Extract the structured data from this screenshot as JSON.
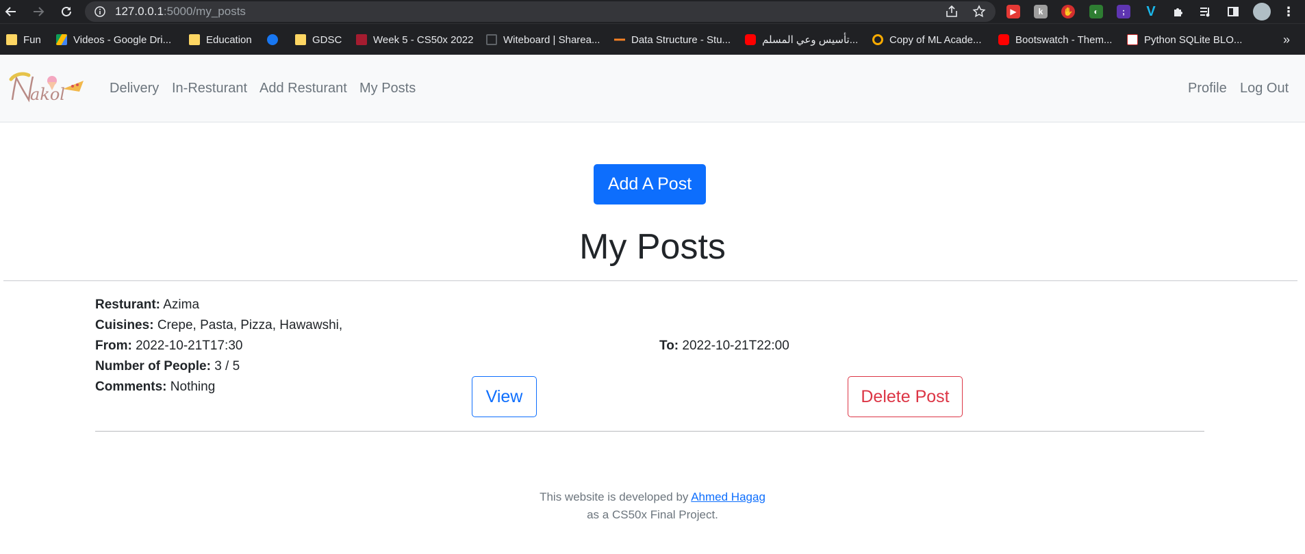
{
  "browser": {
    "url_host": "127.0.0.1",
    "url_path": ":5000/my_posts",
    "bookmarks": [
      {
        "label": "Fun",
        "icon": "folder-icon"
      },
      {
        "label": "Videos - Google Dri...",
        "icon": "google-drive-icon"
      },
      {
        "label": "Education",
        "icon": "folder-icon"
      },
      {
        "label": "",
        "icon": "facebook-icon"
      },
      {
        "label": "GDSC",
        "icon": "folder-icon"
      },
      {
        "label": "Week 5 - CS50x 2022",
        "icon": "harvard-icon"
      },
      {
        "label": "Witeboard | Sharea...",
        "icon": "witeboard-icon"
      },
      {
        "label": "Data Structure - Stu...",
        "icon": "stackoverflow-icon"
      },
      {
        "label": "تأسيس وعي المسلم...",
        "icon": "youtube-icon"
      },
      {
        "label": "Copy of ML Acade...",
        "icon": "colab-icon"
      },
      {
        "label": "Bootswatch - Them...",
        "icon": "youtube-icon"
      },
      {
        "label": "Python SQLite BLO...",
        "icon": "pynative-icon"
      }
    ],
    "more_bookmarks": "»"
  },
  "navbar": {
    "brand": "Nakol",
    "links": [
      "Delivery",
      "In-Resturant",
      "Add Resturant",
      "My Posts"
    ],
    "profile": "Profile",
    "logout": "Log Out"
  },
  "main": {
    "add_button": "Add A Post",
    "title": "My Posts",
    "post": {
      "restaurant_label": "Resturant:",
      "restaurant": "Azima",
      "cuisines_label": "Cuisines:",
      "cuisines": "Crepe, Pasta, Pizza, Hawawshi,",
      "from_label": "From:",
      "from": "2022-10-21T17:30",
      "to_label": "To:",
      "to": "2022-10-21T22:00",
      "people_label": "Number of People:",
      "people": "3 / 5",
      "comments_label": "Comments:",
      "comments": "Nothing",
      "view_button": "View",
      "delete_button": "Delete Post"
    }
  },
  "footer": {
    "line1_prefix": "This website is developed by",
    "author": "Ahmed Hagag",
    "line2": "as a CS50x Final Project."
  },
  "colors": {
    "primary": "#0d6efd",
    "danger": "#dc3545",
    "navbar_bg": "#f8f9fa",
    "chrome_bg": "#202124"
  }
}
